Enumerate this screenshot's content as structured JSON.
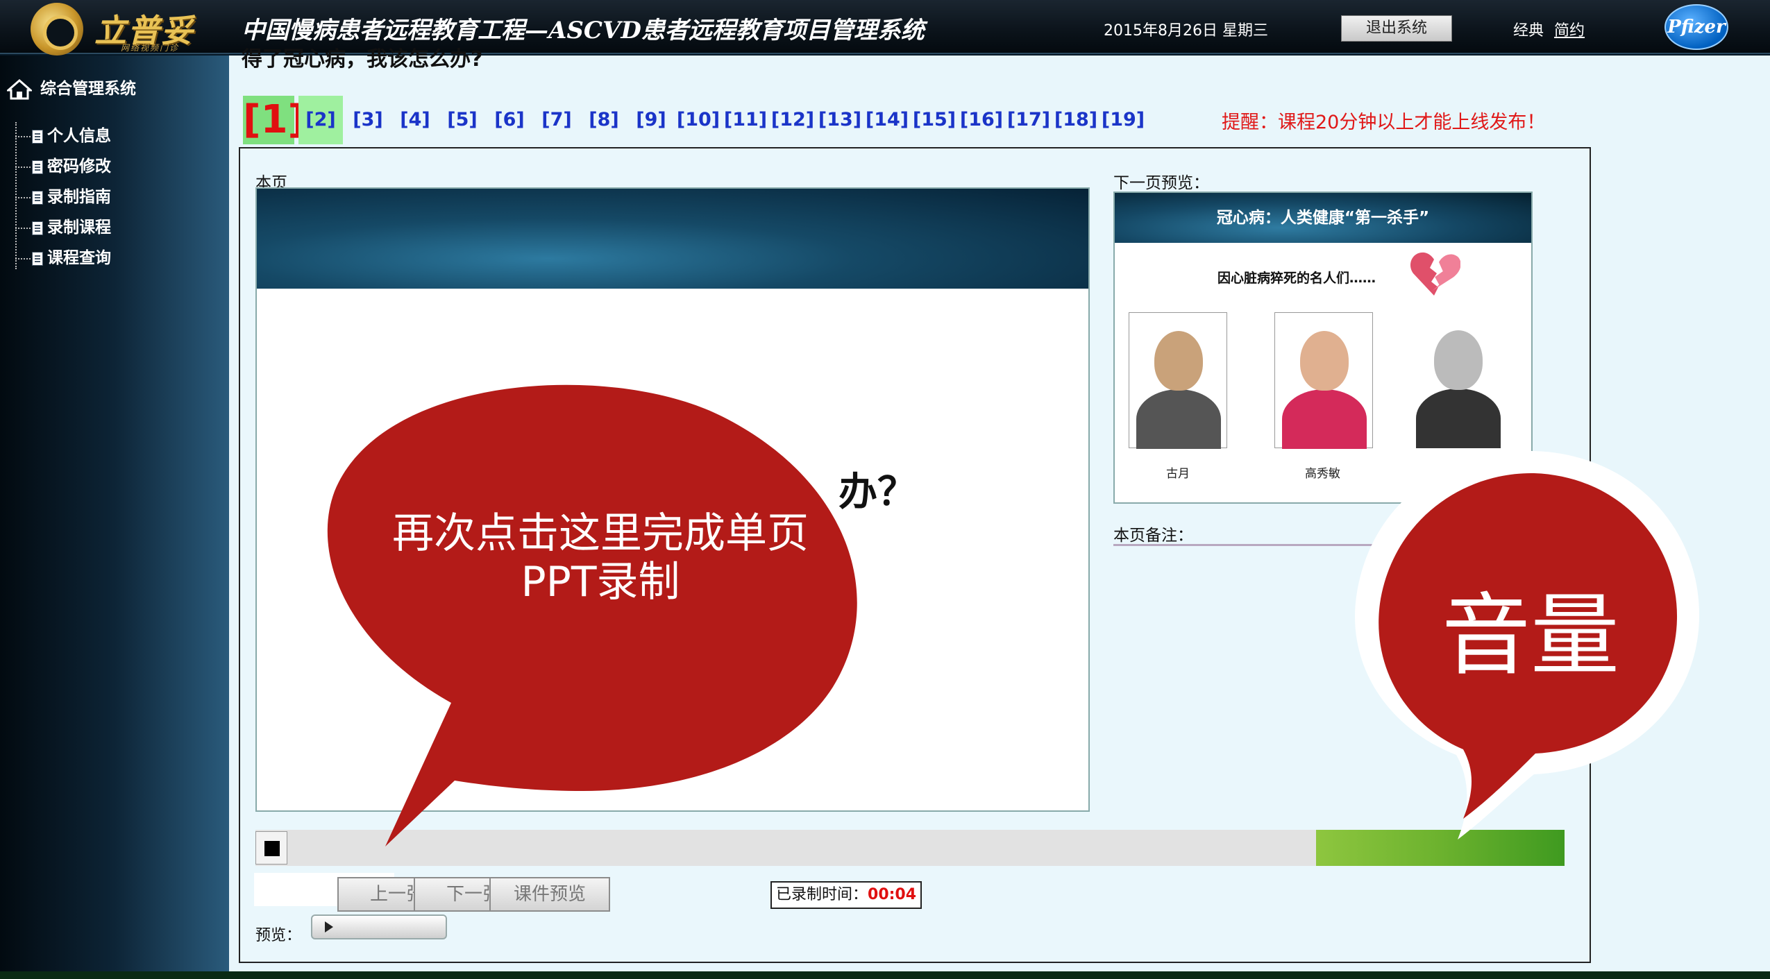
{
  "header": {
    "logo_text": "立普妥",
    "logo_sub": "网络视频门诊",
    "title": "中国慢病患者远程教育工程—ASCVD患者远程教育项目管理系统",
    "date": "2015年8月26日  星期三",
    "logout_label": "退出系统",
    "style_classic": "经典",
    "style_simple": "简约",
    "brand": "Pfizer"
  },
  "sidebar": {
    "root_label": "综合管理系统",
    "items": [
      {
        "label": "个人信息"
      },
      {
        "label": "密码修改"
      },
      {
        "label": "录制指南"
      },
      {
        "label": "录制课程"
      },
      {
        "label": "课程查询"
      }
    ]
  },
  "main": {
    "cut_title": "得了冠心病，我该怎么办?",
    "pages": [
      "[1]",
      "[2]",
      "[3]",
      "[4]",
      "[5]",
      "[6]",
      "[7]",
      "[8]",
      "[9]",
      "[10]",
      "[11]",
      "[12]",
      "[13]",
      "[14]",
      "[15]",
      "[16]",
      "[17]",
      "[18]",
      "[19]"
    ],
    "current_page": 1,
    "reminder": "提醒：课程20分钟以上才能上线发布！",
    "current_label": "本页",
    "slide_text": "办？",
    "next_label": "下一页预览：",
    "next_slide": {
      "title": "冠心病：人类健康“第一杀手”",
      "subtitle": "因心脏病猝死的名人们……",
      "people": [
        {
          "name": "古月"
        },
        {
          "name": "高秀敏"
        },
        {
          "name": ""
        }
      ]
    },
    "notes_label": "本页备注：",
    "volume_level": 0.19,
    "buttons": {
      "prev": "上一张",
      "next": "下一张",
      "preview": "课件预览"
    },
    "recorded_label": "已录制时间：",
    "recorded_time": "00:04",
    "preview_label": "预览："
  },
  "callouts": {
    "left": "再次点击这里完成单页PPT录制",
    "right": "音量",
    "color": "#b31b18"
  }
}
